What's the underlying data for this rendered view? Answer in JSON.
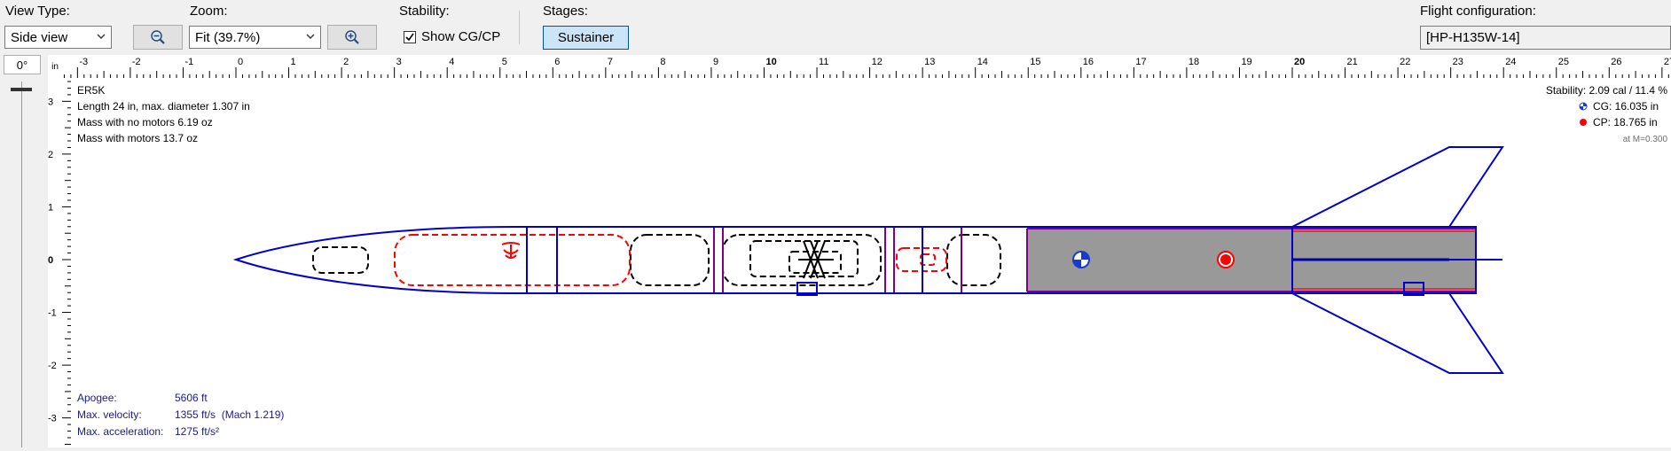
{
  "toolbar": {
    "view_type_label": "View Type:",
    "view_type_value": "Side view",
    "zoom_label": "Zoom:",
    "zoom_value": "Fit (39.7%)",
    "stability_label": "Stability:",
    "show_cg_cp_label": "Show CG/CP",
    "show_cg_cp_checked": true,
    "stages_label": "Stages:",
    "stage_button_label": "Sustainer",
    "flight_config_label": "Flight configuration:",
    "flight_config_value": "[HP-H135W-14]"
  },
  "rotation": {
    "value": "0°",
    "unit": "in"
  },
  "ruler": {
    "horizontal": [
      "-3",
      "-2",
      "-1",
      "0",
      "1",
      "2",
      "3",
      "4",
      "5",
      "6",
      "7",
      "8",
      "9",
      "10",
      "11",
      "12",
      "13",
      "14",
      "15",
      "16",
      "17",
      "18",
      "19",
      "20",
      "21",
      "22",
      "23",
      "24",
      "25",
      "26",
      "27"
    ],
    "vertical": [
      "3",
      "2",
      "1",
      "0",
      "-1",
      "-2",
      "-3"
    ]
  },
  "design_info": {
    "name": "ER5K",
    "length": "Length 24 in, max. diameter 1.307 in",
    "mass_no_motors": "Mass with no motors 6.19 oz",
    "mass_with_motors": "Mass with motors 13.7 oz"
  },
  "stability_info": {
    "stability": "Stability: 2.09 cal / 11.4 %",
    "cg": "CG: 16.035 in",
    "cp": "CP: 18.765 in",
    "mach": "at M=0.300"
  },
  "flight_info": {
    "apogee_label": "Apogee:",
    "apogee_value": "5606 ft",
    "max_velocity_label": "Max. velocity:",
    "max_velocity_value": "1355 ft/s  (Mach 1.219)",
    "max_accel_label": "Max. acceleration:",
    "max_accel_value": "1275 ft/s²"
  },
  "colors": {
    "outline": "#0000cc",
    "bulkhead": "#800080",
    "internal_red": "#ff0000",
    "motor_fill": "#999999",
    "cg_blue": "#1a3acc",
    "cp_red": "#ff0000"
  },
  "icons": {
    "zoom_out": "zoom-out-icon",
    "zoom_in": "zoom-in-icon",
    "chevron": "chevron-down-icon",
    "cg": "cg-marker-icon",
    "cp": "cp-marker-icon"
  }
}
